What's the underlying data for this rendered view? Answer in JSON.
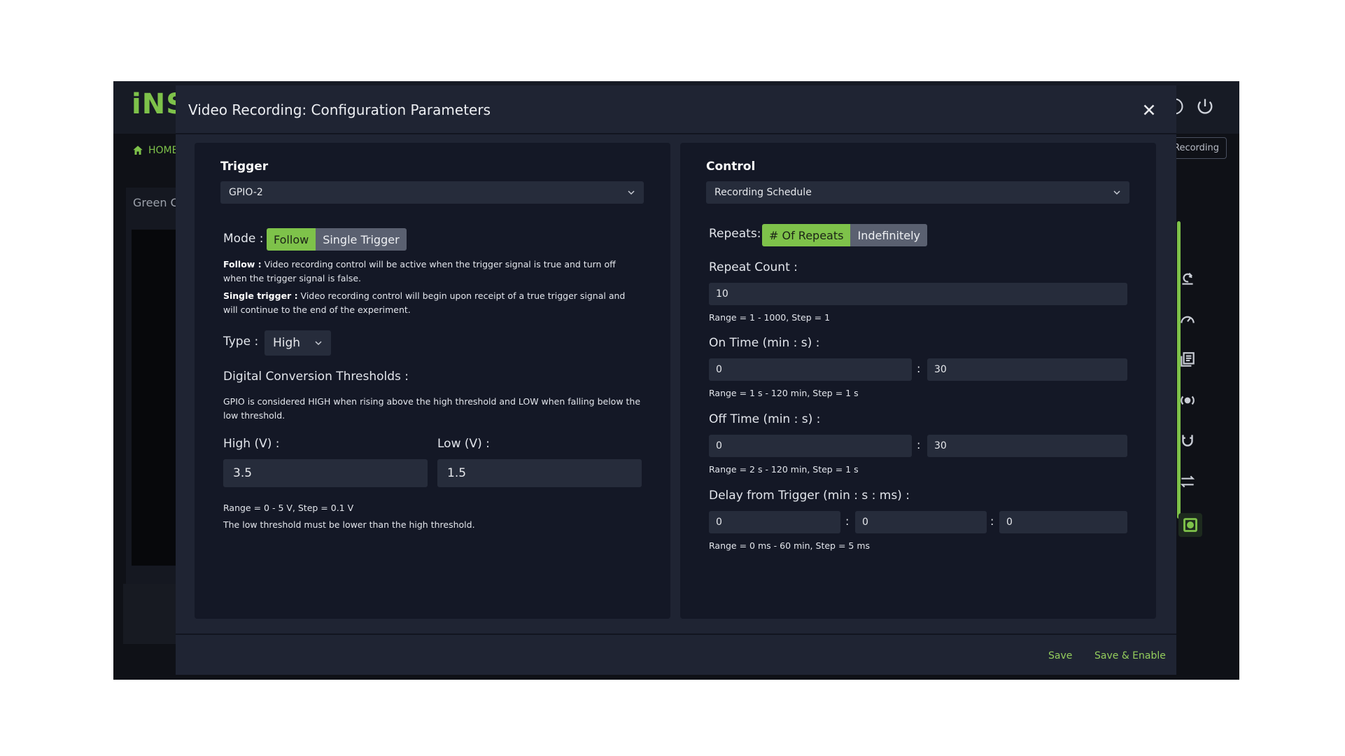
{
  "app": {
    "logo": "iNS",
    "home_label": "HOME",
    "recording_tag": "Recording",
    "left_panel_label": "Green C"
  },
  "modal": {
    "title": "Video Recording: Configuration Parameters",
    "close_icon": "close-icon",
    "trigger": {
      "title": "Trigger",
      "source": "GPIO-2",
      "mode_label": "Mode :",
      "mode_options": [
        "Follow",
        "Single Trigger"
      ],
      "mode_selected": "Follow",
      "follow_term": "Follow :",
      "follow_desc": "Video recording control will be active when the trigger signal is true and turn off when the trigger signal is false.",
      "single_term": "Single trigger :",
      "single_desc": "Video recording control will begin upon receipt of a true trigger signal and will continue to the end of the experiment.",
      "type_label": "Type :",
      "type_value": "High",
      "thresholds_label": "Digital Conversion Thresholds :",
      "thresholds_desc": "GPIO is considered HIGH when rising above the high threshold and LOW when falling below the low threshold.",
      "high_label": "High (V) :",
      "high_value": "3.5",
      "low_label": "Low (V) :",
      "low_value": "1.5",
      "range_note": "Range = 0 - 5 V, Step = 0.1 V",
      "order_note": "The low threshold must be lower than the high threshold."
    },
    "control": {
      "title": "Control",
      "schedule": "Recording Schedule",
      "repeats_label": "Repeats:",
      "repeats_options": [
        "# Of Repeats",
        "Indefinitely"
      ],
      "repeats_selected": "# Of Repeats",
      "repeat_count_label": "Repeat Count :",
      "repeat_count_value": "10",
      "repeat_count_range": "Range = 1 - 1000, Step = 1",
      "on_time_label": "On Time (min : s) :",
      "on_time_min": "0",
      "on_time_sec": "30",
      "on_time_range": "Range = 1 s - 120 min, Step = 1 s",
      "off_time_label": "Off Time (min : s) :",
      "off_time_min": "0",
      "off_time_sec": "30",
      "off_time_range": "Range = 2 s - 120 min, Step = 1 s",
      "delay_label": "Delay from Trigger (min : s : ms) :",
      "delay_min": "0",
      "delay_sec": "0",
      "delay_ms": "0",
      "delay_range": "Range = 0 ms - 60 min, Step = 5 ms"
    },
    "footer": {
      "save": "Save",
      "save_enable": "Save & Enable"
    }
  },
  "colors": {
    "accent": "#7ec24a",
    "modal_bg": "#1f2433",
    "panel_bg": "#141826",
    "input_bg": "#262c3b"
  },
  "colon": ":"
}
